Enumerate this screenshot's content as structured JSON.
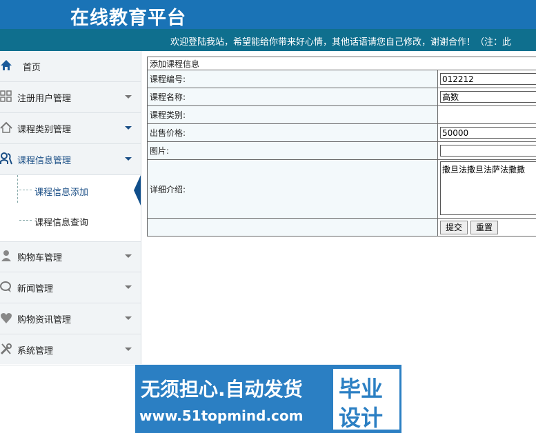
{
  "header": {
    "title": "在线教育平台",
    "marquee": "欢迎登陆我站，希望能给你带来好心情，其他话语请您自己修改，谢谢合作！（注：此"
  },
  "sidebar": {
    "items": [
      {
        "label": "首页",
        "icon": "home-icon"
      },
      {
        "label": "注册用户管理",
        "icon": "grid-icon"
      },
      {
        "label": "课程类别管理",
        "icon": "house-icon"
      },
      {
        "label": "课程信息管理",
        "icon": "users-icon"
      },
      {
        "label": "购物车管理",
        "icon": "user-icon"
      },
      {
        "label": "新闻管理",
        "icon": "chat-icon"
      },
      {
        "label": "购物资讯管理",
        "icon": "heart-icon"
      },
      {
        "label": "系统管理",
        "icon": "tools-icon"
      }
    ],
    "submenu": [
      {
        "label": "课程信息添加"
      },
      {
        "label": "课程信息查询"
      }
    ]
  },
  "form": {
    "caption": "添加课程信息",
    "fields": {
      "code": {
        "label": "课程编号:",
        "value": "012212"
      },
      "name": {
        "label": "课程名称:",
        "value": "高数"
      },
      "category": {
        "label": "课程类别:"
      },
      "price": {
        "label": "出售价格:",
        "value": "50000"
      },
      "image": {
        "label": "图片:",
        "value": ""
      },
      "detail": {
        "label": "详细介绍:",
        "value": "撒旦法撒旦法萨法撒撒"
      }
    },
    "submit_label": "提交",
    "reset_label": "重置"
  },
  "watermark": {
    "line1": "无须担心.自动发货",
    "line2": "www.51topmind.com",
    "badge_top": "毕业",
    "badge_bottom": "设计"
  },
  "colors": {
    "header_bg": "#1a73b6",
    "marquee_bg": "#0f6f8e",
    "active_menu": "#1b4f86",
    "watermark_bg": "#2b7fc3"
  }
}
